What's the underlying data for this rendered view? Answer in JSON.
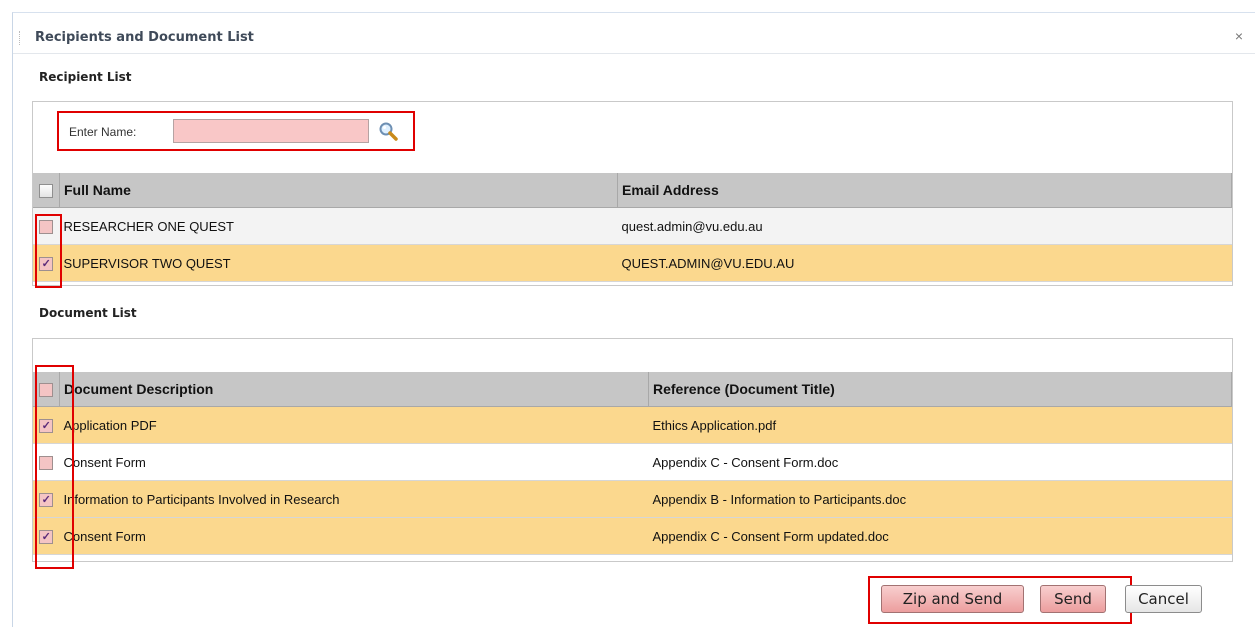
{
  "dialog": {
    "title": "Recipients and Document List",
    "close_glyph": "×"
  },
  "recipients": {
    "section_label": "Recipient List",
    "search_label": "Enter Name:",
    "search_value": "",
    "columns": [
      "Full Name",
      "Email Address"
    ],
    "rows": [
      {
        "name": "RESEARCHER ONE QUEST",
        "email": "quest.admin@vu.edu.au",
        "checked": false
      },
      {
        "name": "SUPERVISOR TWO QUEST",
        "email": "QUEST.ADMIN@VU.EDU.AU",
        "checked": true
      }
    ]
  },
  "documents": {
    "section_label": "Document List",
    "columns": [
      "Document Description",
      "Reference (Document Title)"
    ],
    "rows": [
      {
        "desc": "Application PDF",
        "ref": "Ethics Application.pdf",
        "checked": true
      },
      {
        "desc": "Consent Form",
        "ref": "Appendix C - Consent Form.doc",
        "checked": false
      },
      {
        "desc": "Information to Participants Involved in Research",
        "ref": "Appendix B - Information to Participants.doc",
        "checked": true
      },
      {
        "desc": "Consent Form",
        "ref": "Appendix C - Consent Form updated.doc",
        "checked": true
      }
    ]
  },
  "buttons": {
    "zip_send": "Zip and Send",
    "send": "Send",
    "cancel": "Cancel"
  },
  "colors": {
    "highlight_red": "#e00000",
    "selected_row": "#fbd88e",
    "header_bg": "#c6c6c6"
  },
  "icons": {
    "search": "magnifier-icon",
    "close": "close-icon"
  }
}
